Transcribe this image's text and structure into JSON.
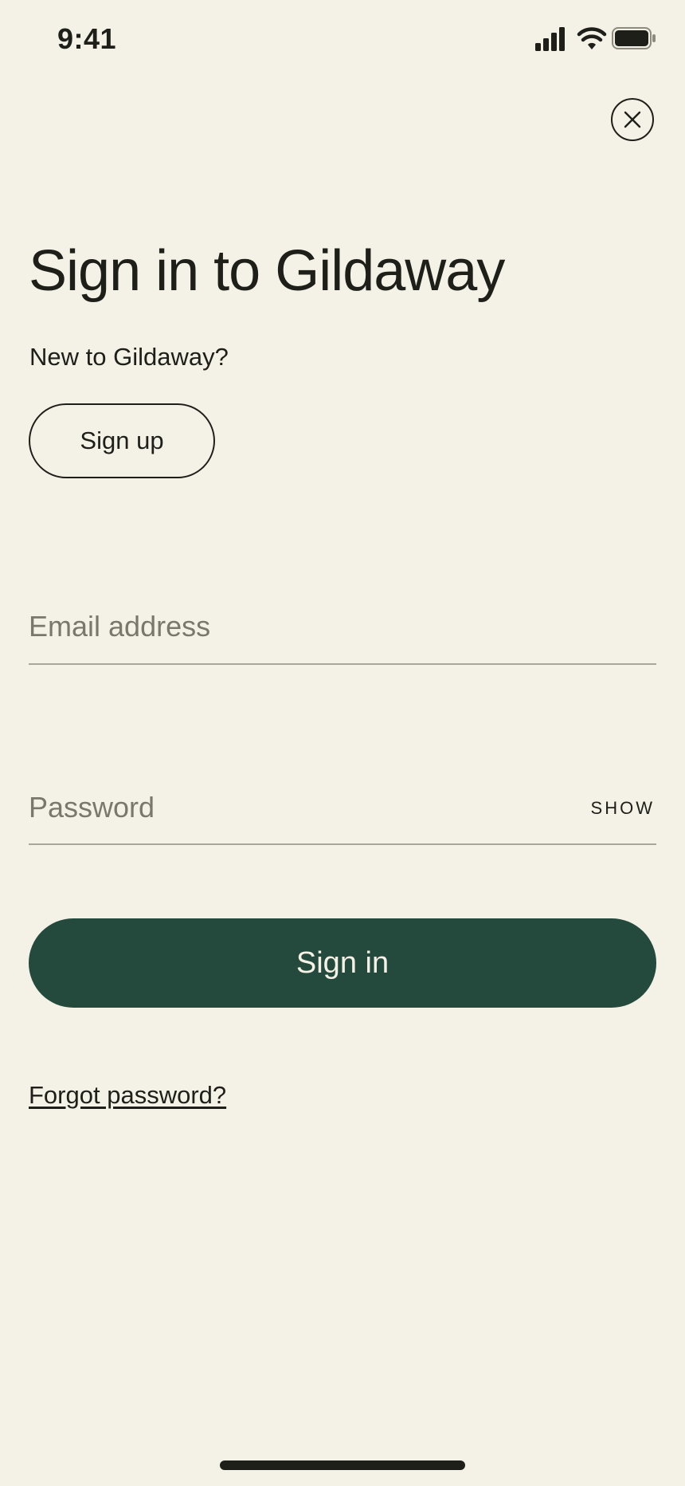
{
  "status_bar": {
    "time": "9:41"
  },
  "header": {
    "close_icon": "close-icon"
  },
  "main": {
    "title": "Sign in to Gildaway",
    "signup_prompt": "New to Gildaway?",
    "signup_label": "Sign up",
    "email": {
      "value": "",
      "placeholder": "Email address"
    },
    "password": {
      "value": "",
      "placeholder": "Password",
      "show_label": "SHOW"
    },
    "signin_label": "Sign in",
    "forgot_label": "Forgot password?"
  },
  "colors": {
    "background": "#f4f1e6",
    "primary": "#244a3d",
    "text": "#1f1f1a"
  }
}
